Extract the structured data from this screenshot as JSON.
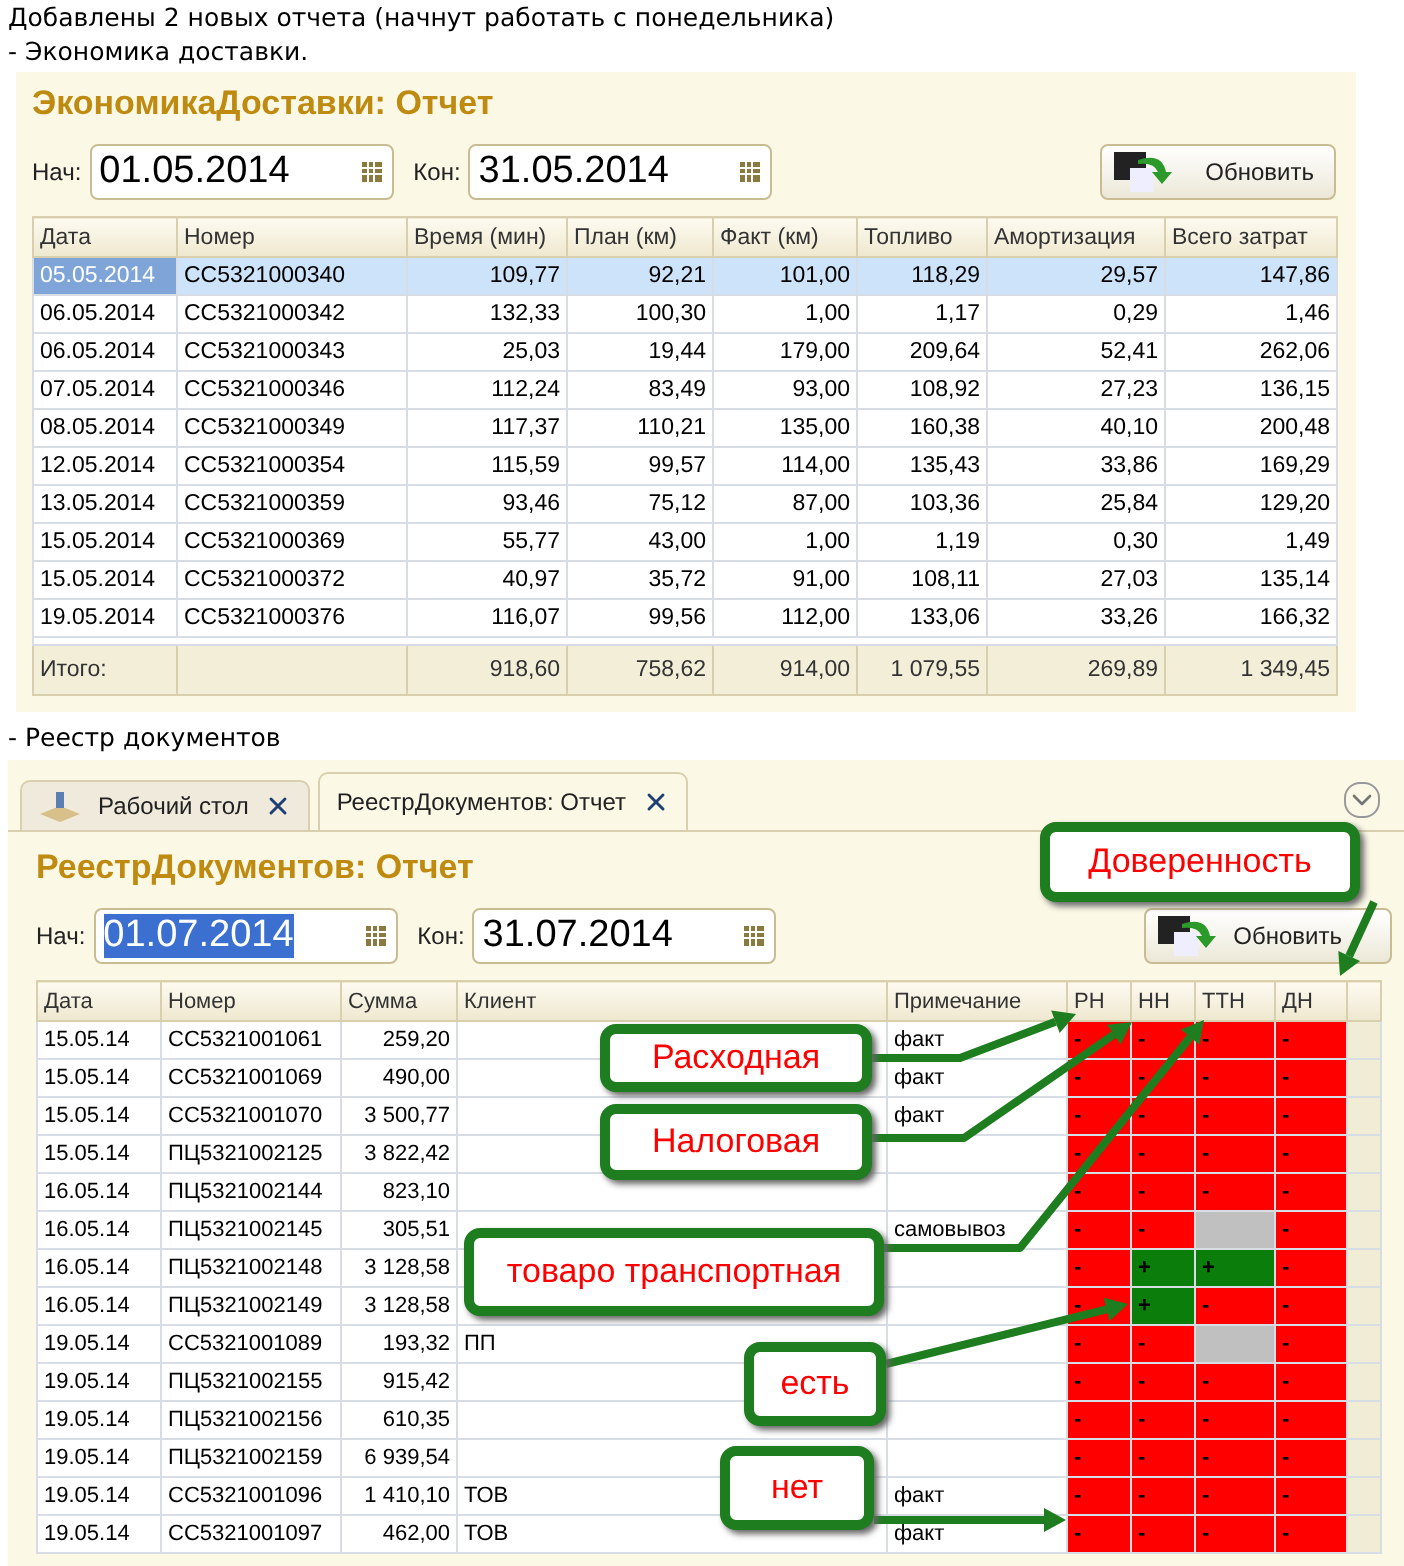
{
  "intro": [
    "Добавлены 2 новых отчета (начнут работать с понедельника)",
    "- Экономика доставки."
  ],
  "report1": {
    "title": "ЭкономикаДоставки: Отчет",
    "start_label": "Нач:",
    "start": "01.05.2014",
    "end_label": "Кон:",
    "end": "31.05.2014",
    "refresh": "Обновить",
    "columns": [
      "Дата",
      "Номер",
      "Время (мин)",
      "План (км)",
      "Факт (км)",
      "Топливо",
      "Амортизация",
      "Всего затрат"
    ],
    "rows": [
      {
        "selected": true,
        "cells": [
          "05.05.2014",
          "СС5321000340",
          "109,77",
          "92,21",
          "101,00",
          "118,29",
          "29,57",
          "147,86"
        ]
      },
      {
        "selected": false,
        "cells": [
          "06.05.2014",
          "СС5321000342",
          "132,33",
          "100,30",
          "1,00",
          "1,17",
          "0,29",
          "1,46"
        ]
      },
      {
        "selected": false,
        "cells": [
          "06.05.2014",
          "СС5321000343",
          "25,03",
          "19,44",
          "179,00",
          "209,64",
          "52,41",
          "262,06"
        ]
      },
      {
        "selected": false,
        "cells": [
          "07.05.2014",
          "СС5321000346",
          "112,24",
          "83,49",
          "93,00",
          "108,92",
          "27,23",
          "136,15"
        ]
      },
      {
        "selected": false,
        "cells": [
          "08.05.2014",
          "СС5321000349",
          "117,37",
          "110,21",
          "135,00",
          "160,38",
          "40,10",
          "200,48"
        ]
      },
      {
        "selected": false,
        "cells": [
          "12.05.2014",
          "СС5321000354",
          "115,59",
          "99,57",
          "114,00",
          "135,43",
          "33,86",
          "169,29"
        ]
      },
      {
        "selected": false,
        "cells": [
          "13.05.2014",
          "СС5321000359",
          "93,46",
          "75,12",
          "87,00",
          "103,36",
          "25,84",
          "129,20"
        ]
      },
      {
        "selected": false,
        "cells": [
          "15.05.2014",
          "СС5321000369",
          "55,77",
          "43,00",
          "1,00",
          "1,19",
          "0,30",
          "1,49"
        ]
      },
      {
        "selected": false,
        "cells": [
          "15.05.2014",
          "СС5321000372",
          "40,97",
          "35,72",
          "91,00",
          "108,11",
          "27,03",
          "135,14"
        ]
      },
      {
        "selected": false,
        "cells": [
          "19.05.2014",
          "СС5321000376",
          "116,07",
          "99,56",
          "112,00",
          "133,06",
          "33,26",
          "166,32"
        ]
      }
    ],
    "totals": {
      "label": "Итого:",
      "values": [
        "918,60",
        "758,62",
        "914,00",
        "1 079,55",
        "269,89",
        "1 349,45"
      ]
    }
  },
  "section2": "- Реестр документов",
  "tabs": [
    {
      "label": "Рабочий стол",
      "selected": false
    },
    {
      "label": "РеестрДокументов: Отчет",
      "selected": true
    }
  ],
  "report2": {
    "title": "РеестрДокументов: Отчет",
    "start_label": "Нач:",
    "start": "01.07.2014",
    "start_highlighted": true,
    "end_label": "Кон:",
    "end": "31.07.2014",
    "refresh": "Обновить",
    "columns": [
      "Дата",
      "Номер",
      "Сумма",
      "Клиент",
      "Примечание",
      "РН",
      "НН",
      "ТТН",
      "ДН"
    ],
    "rows": [
      {
        "cells": [
          "15.05.14",
          "СС5321001061",
          "259,20",
          "",
          "факт"
        ],
        "flags": [
          {
            "mark": "-",
            "color": "#ff0000"
          },
          {
            "mark": "-",
            "color": "#ff0000"
          },
          {
            "mark": "-",
            "color": "#ff0000"
          },
          {
            "mark": "-",
            "color": "#ff0000"
          }
        ]
      },
      {
        "cells": [
          "15.05.14",
          "СС5321001069",
          "490,00",
          "",
          "факт"
        ],
        "flags": [
          {
            "mark": "-",
            "color": "#ff0000"
          },
          {
            "mark": "-",
            "color": "#ff0000"
          },
          {
            "mark": "-",
            "color": "#ff0000"
          },
          {
            "mark": "-",
            "color": "#ff0000"
          }
        ]
      },
      {
        "cells": [
          "15.05.14",
          "СС5321001070",
          "3 500,77",
          "",
          "факт"
        ],
        "flags": [
          {
            "mark": "-",
            "color": "#ff0000"
          },
          {
            "mark": "-",
            "color": "#ff0000"
          },
          {
            "mark": "-",
            "color": "#ff0000"
          },
          {
            "mark": "-",
            "color": "#ff0000"
          }
        ]
      },
      {
        "cells": [
          "15.05.14",
          "ПЦ5321002125",
          "3 822,42",
          "",
          ""
        ],
        "flags": [
          {
            "mark": "-",
            "color": "#ff0000"
          },
          {
            "mark": "-",
            "color": "#ff0000"
          },
          {
            "mark": "-",
            "color": "#ff0000"
          },
          {
            "mark": "-",
            "color": "#ff0000"
          }
        ]
      },
      {
        "cells": [
          "16.05.14",
          "ПЦ5321002144",
          "823,10",
          "",
          ""
        ],
        "flags": [
          {
            "mark": "-",
            "color": "#ff0000"
          },
          {
            "mark": "-",
            "color": "#ff0000"
          },
          {
            "mark": "-",
            "color": "#ff0000"
          },
          {
            "mark": "-",
            "color": "#ff0000"
          }
        ]
      },
      {
        "cells": [
          "16.05.14",
          "ПЦ5321002145",
          "305,51",
          "",
          "самовывоз"
        ],
        "flags": [
          {
            "mark": "-",
            "color": "#ff0000"
          },
          {
            "mark": "-",
            "color": "#ff0000"
          },
          {
            "color": "#c0c0c0"
          },
          {
            "mark": "-",
            "color": "#ff0000"
          }
        ]
      },
      {
        "cells": [
          "16.05.14",
          "ПЦ5321002148",
          "3 128,58",
          "",
          ""
        ],
        "flags": [
          {
            "mark": "-",
            "color": "#ff0000"
          },
          {
            "mark": "+",
            "color": "#0a7d0a"
          },
          {
            "mark": "+",
            "color": "#0a7d0a"
          },
          {
            "mark": "-",
            "color": "#ff0000"
          }
        ]
      },
      {
        "cells": [
          "16.05.14",
          "ПЦ5321002149",
          "3 128,58",
          "",
          ""
        ],
        "flags": [
          {
            "mark": "-",
            "color": "#ff0000"
          },
          {
            "mark": "+",
            "color": "#0a7d0a"
          },
          {
            "mark": "-",
            "color": "#ff0000"
          },
          {
            "mark": "-",
            "color": "#ff0000"
          }
        ]
      },
      {
        "cells": [
          "19.05.14",
          "СС5321001089",
          "193,32",
          "ПП",
          ""
        ],
        "flags": [
          {
            "mark": "-",
            "color": "#ff0000"
          },
          {
            "mark": "-",
            "color": "#ff0000"
          },
          {
            "color": "#c0c0c0"
          },
          {
            "mark": "-",
            "color": "#ff0000"
          }
        ]
      },
      {
        "cells": [
          "19.05.14",
          "ПЦ5321002155",
          "915,42",
          "",
          ""
        ],
        "flags": [
          {
            "mark": "-",
            "color": "#ff0000"
          },
          {
            "mark": "-",
            "color": "#ff0000"
          },
          {
            "mark": "-",
            "color": "#ff0000"
          },
          {
            "mark": "-",
            "color": "#ff0000"
          }
        ]
      },
      {
        "cells": [
          "19.05.14",
          "ПЦ5321002156",
          "610,35",
          "",
          ""
        ],
        "flags": [
          {
            "mark": "-",
            "color": "#ff0000"
          },
          {
            "mark": "-",
            "color": "#ff0000"
          },
          {
            "mark": "-",
            "color": "#ff0000"
          },
          {
            "mark": "-",
            "color": "#ff0000"
          }
        ]
      },
      {
        "cells": [
          "19.05.14",
          "ПЦ5321002159",
          "6 939,54",
          "",
          ""
        ],
        "flags": [
          {
            "mark": "-",
            "color": "#ff0000"
          },
          {
            "mark": "-",
            "color": "#ff0000"
          },
          {
            "mark": "-",
            "color": "#ff0000"
          },
          {
            "mark": "-",
            "color": "#ff0000"
          }
        ]
      },
      {
        "cells": [
          "19.05.14",
          "СС5321001096",
          "1 410,10",
          "ТОВ",
          "факт"
        ],
        "flags": [
          {
            "mark": "-",
            "color": "#ff0000"
          },
          {
            "mark": "-",
            "color": "#ff0000"
          },
          {
            "mark": "-",
            "color": "#ff0000"
          },
          {
            "mark": "-",
            "color": "#ff0000"
          }
        ]
      },
      {
        "cells": [
          "19.05.14",
          "СС5321001097",
          "462,00",
          "ТОВ",
          "факт"
        ],
        "flags": [
          {
            "mark": "-",
            "color": "#ff0000"
          },
          {
            "mark": "-",
            "color": "#ff0000"
          },
          {
            "mark": "-",
            "color": "#ff0000"
          },
          {
            "mark": "-",
            "color": "#ff0000"
          }
        ]
      }
    ]
  },
  "callouts": [
    "Доверенность",
    "Расходная",
    "Налоговая",
    "товаро транспортная",
    "есть",
    "нет"
  ]
}
